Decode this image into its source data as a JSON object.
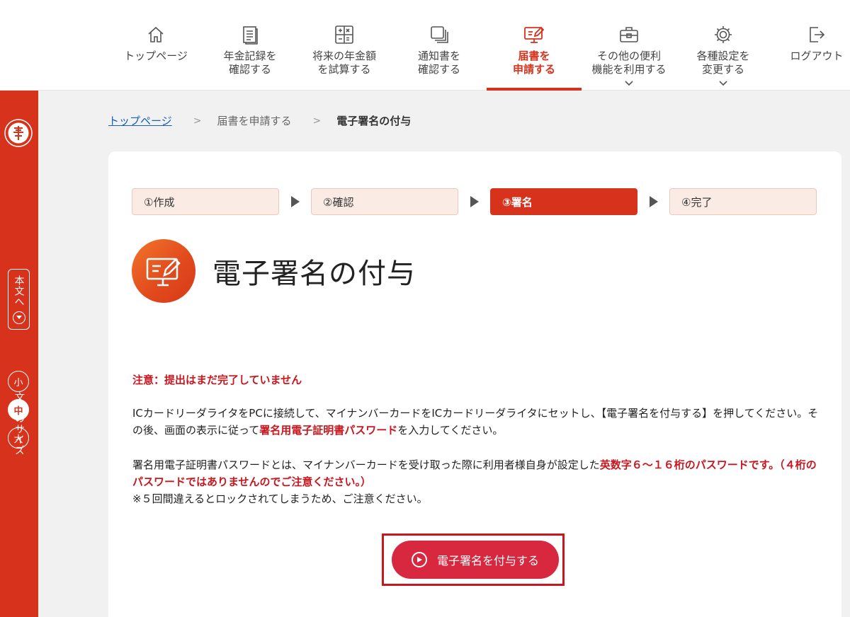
{
  "nav": {
    "items": [
      {
        "label": "トップページ"
      },
      {
        "label": "年金記録を\n確認する"
      },
      {
        "label": "将来の年金額\nを試算する"
      },
      {
        "label": "通知書を\n確認する"
      },
      {
        "label": "届書を\n申請する"
      },
      {
        "label": "その他の便利\n機能を利用する"
      },
      {
        "label": "各種設定を\n変更する"
      },
      {
        "label": "ログアウト"
      }
    ]
  },
  "sidebar": {
    "to_main": "本文へ",
    "font_size_title": "文字のサイズ",
    "font_sizes": [
      "小",
      "中",
      "大"
    ]
  },
  "breadcrumb": {
    "home": "トップページ",
    "middle": "届書を申請する",
    "current": "電子署名の付与"
  },
  "steps": [
    "①作成",
    "②確認",
    "③署名",
    "④完了"
  ],
  "page": {
    "title": "電子署名の付与",
    "notice": "注意：提出はまだ完了していません",
    "p1_a": "ICカードリーダライタをPCに接続して、マイナンバーカードをICカードリーダライタにセットし、【電子署名を付与する】を押してください。その後、画面の表示に従って",
    "p1_hl": "署名用電子証明書パスワード",
    "p1_b": "を入力してください。",
    "p2_a": "署名用電子証明書パスワードとは、マイナンバーカードを受け取った際に利用者様自身が設定した",
    "p2_hl": "英数字６～１６桁のパスワードです。（４桁のパスワードではありませんのでご注意ください。）",
    "p2_note": "※５回間違えるとロックされてしまうため、ご注意ください。",
    "button": "電子署名を付与する"
  },
  "colors": {
    "accent": "#d7321c",
    "button": "#d8283f",
    "highlight": "#c8171e"
  }
}
